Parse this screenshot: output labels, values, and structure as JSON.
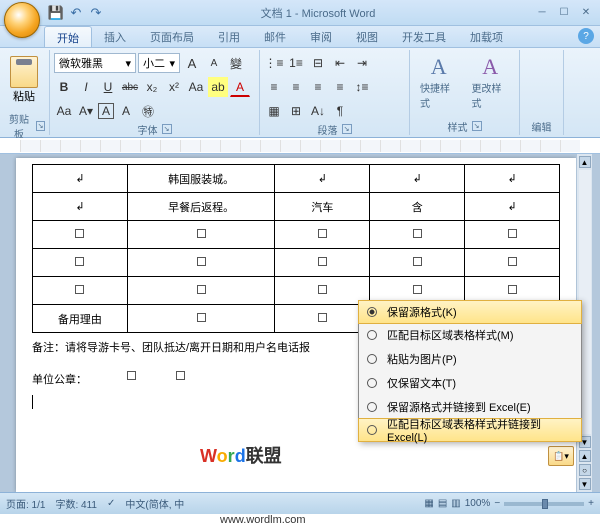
{
  "title": "文档 1 - Microsoft Word",
  "qat": {
    "save": "💾",
    "undo": "↶",
    "redo": "↷"
  },
  "tabs": [
    "开始",
    "插入",
    "页面布局",
    "引用",
    "邮件",
    "审阅",
    "视图",
    "开发工具",
    "加载项"
  ],
  "ribbon": {
    "clipboard": {
      "label": "剪贴板",
      "paste": "粘贴"
    },
    "font": {
      "label": "字体",
      "name": "微软雅黑",
      "size": "小二",
      "grow": "A",
      "shrink": "A",
      "clear": "Aa",
      "bold": "B",
      "italic": "I",
      "underline": "U",
      "strike": "abc",
      "sub": "x₂",
      "sup": "x²",
      "highlight": "ab",
      "color": "A",
      "case": "Aa",
      "border": "A",
      "phonetic": "變"
    },
    "para": {
      "label": "段落",
      "bullets": "≡",
      "numbering": "⋮≡",
      "multilevel": "⊟",
      "dec_indent": "⇤",
      "inc_indent": "⇥",
      "align_l": "≡",
      "align_c": "≡",
      "align_r": "≡",
      "align_j": "≡",
      "spacing": "↕",
      "shading": "▦",
      "borders": "⊞",
      "sort": "A↓",
      "show": "¶"
    },
    "styles": {
      "label": "样式",
      "quick": "快捷样式",
      "change": "更改样式"
    },
    "editing": {
      "label": "编辑"
    }
  },
  "table": {
    "rows": [
      [
        "",
        "韩国服装城。",
        "",
        "",
        ""
      ],
      [
        "",
        "早餐后返程。",
        "汽车",
        "含",
        ""
      ],
      [
        "",
        "",
        "",
        "",
        ""
      ],
      [
        "",
        "",
        "",
        "",
        ""
      ],
      [
        "",
        "",
        "",
        "",
        ""
      ],
      [
        "备用理由",
        "",
        "",
        "",
        ""
      ]
    ],
    "note": "备注：请将导游卡号、团队抵达/离开日期和用户名电话报",
    "stamp": "单位公章："
  },
  "menu": {
    "items": [
      "保留源格式(K)",
      "匹配目标区域表格样式(M)",
      "粘贴为图片(P)",
      "仅保留文本(T)",
      "保留源格式并链接到 Excel(E)",
      "匹配目标区域表格样式并链接到 Excel(L)"
    ]
  },
  "status": {
    "page": "页面: 1/1",
    "words": "字数: 411",
    "lang": "中文(简体, 中",
    "zoom": "100%",
    "minus": "−",
    "plus": "+"
  },
  "watermark": {
    "text": "Word联盟",
    "url": "www.wordlm.com"
  }
}
